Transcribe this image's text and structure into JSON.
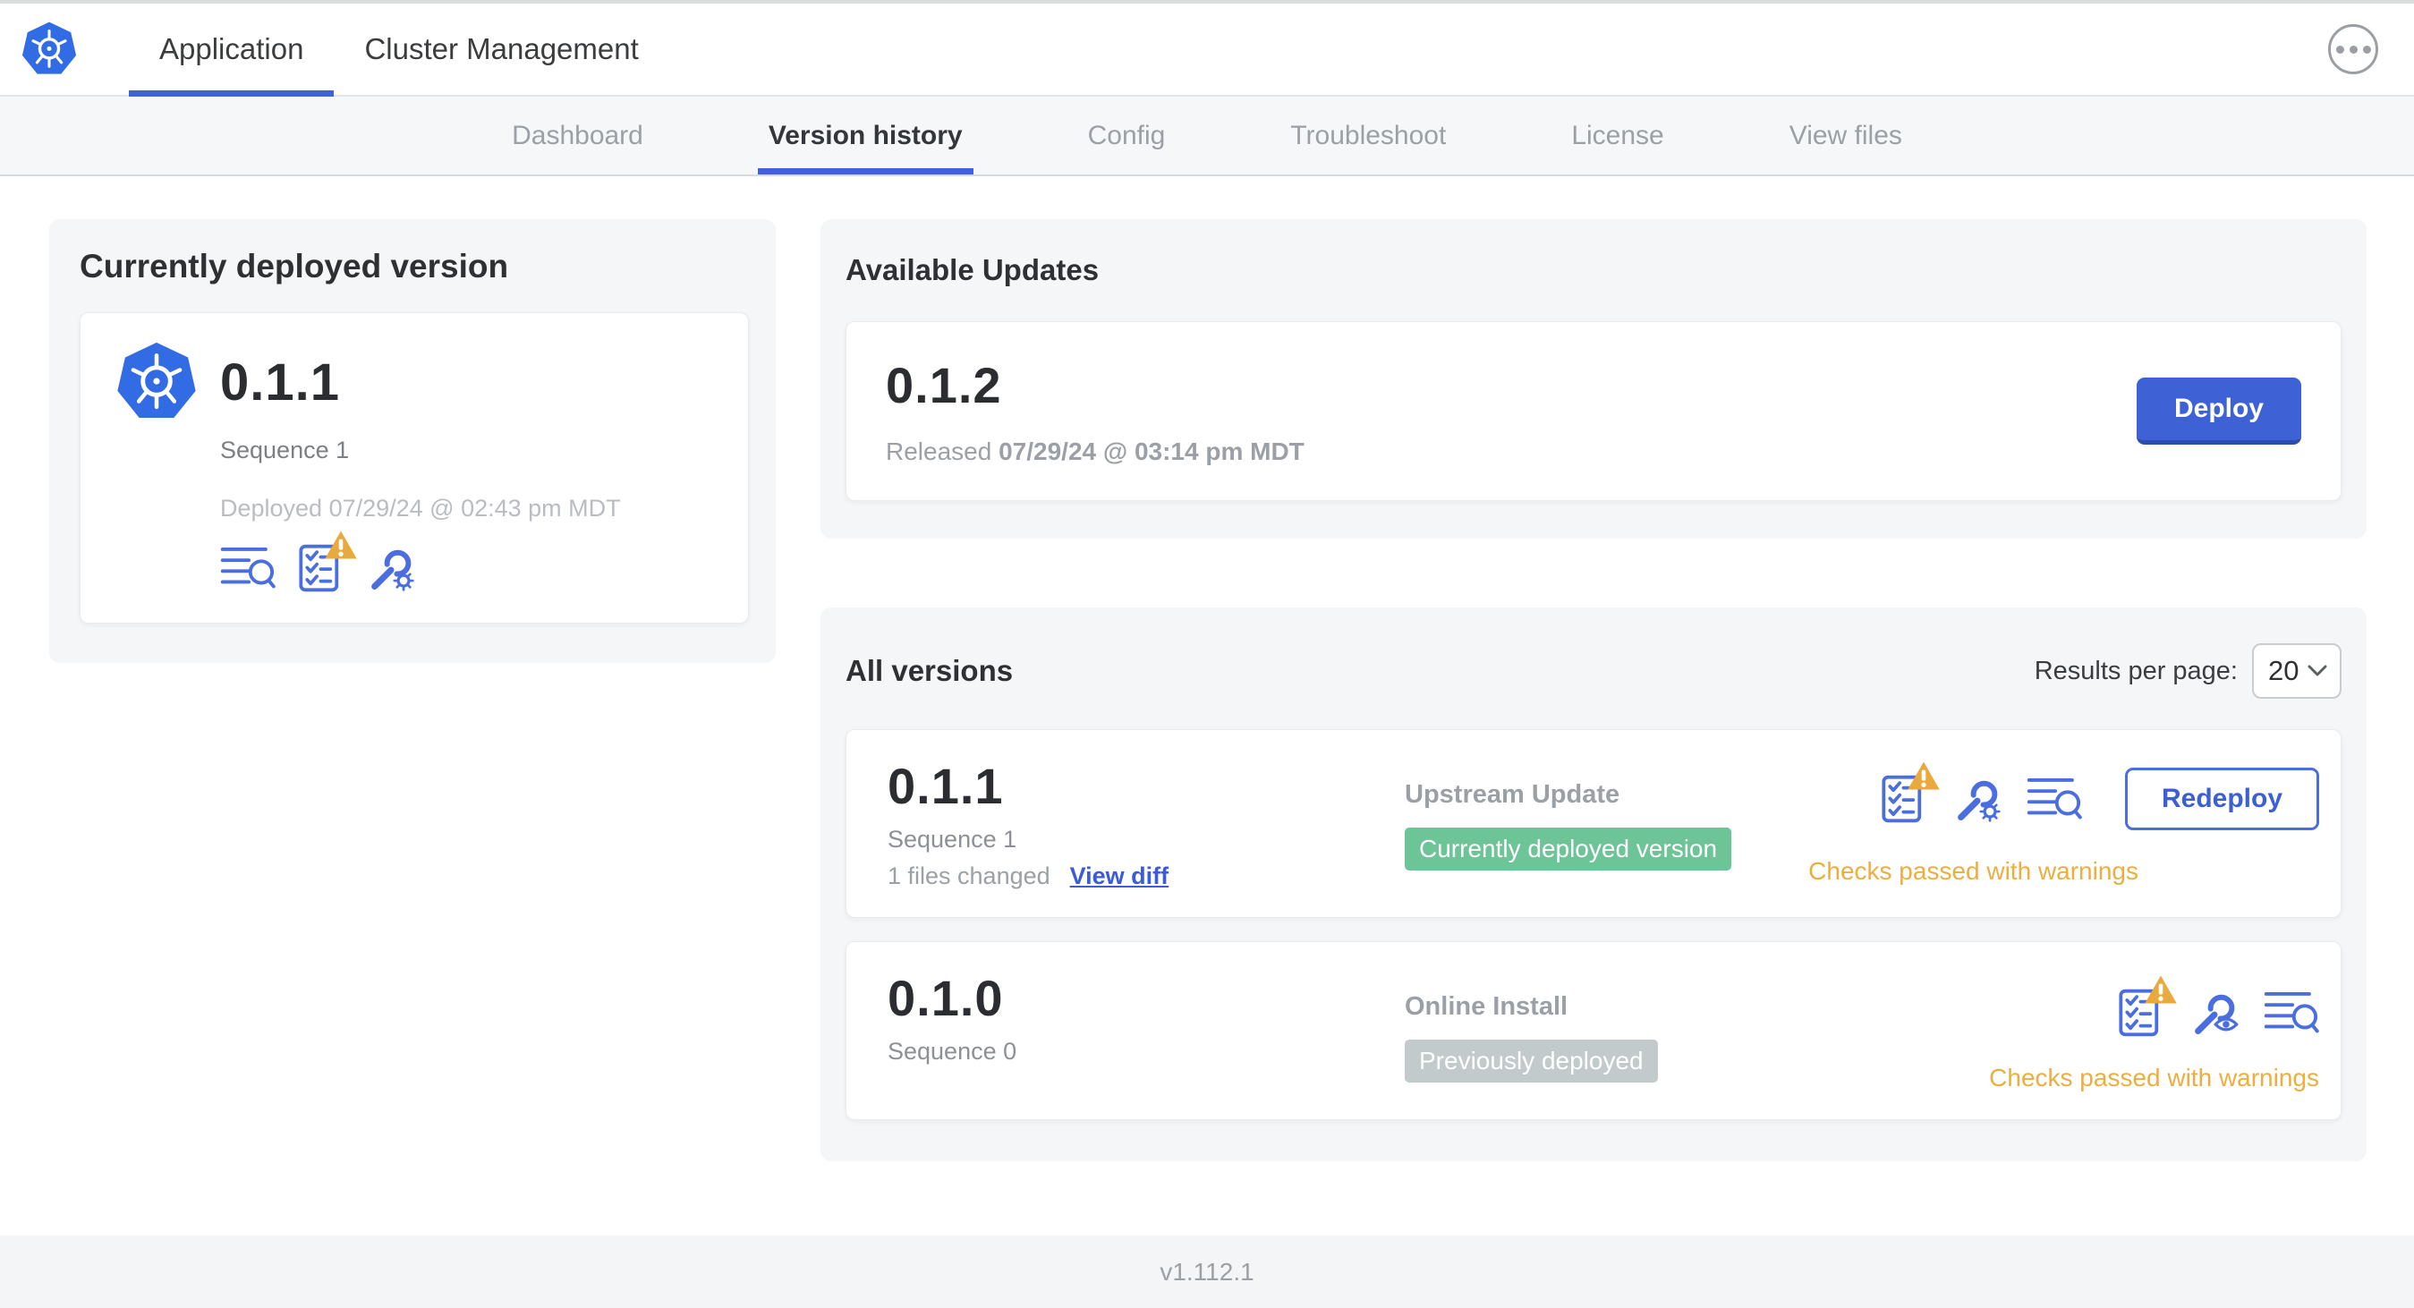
{
  "header": {
    "logo_icon": "kubernetes-logo-icon",
    "tabs": [
      {
        "label": "Application",
        "active": true
      },
      {
        "label": "Cluster Management",
        "active": false
      }
    ],
    "more_menu_icon": "ellipsis-menu-icon"
  },
  "subnav": {
    "tabs": [
      {
        "label": "Dashboard",
        "active": false
      },
      {
        "label": "Version history",
        "active": true
      },
      {
        "label": "Config",
        "active": false
      },
      {
        "label": "Troubleshoot",
        "active": false
      },
      {
        "label": "License",
        "active": false
      },
      {
        "label": "View files",
        "active": false
      }
    ]
  },
  "current_version_card": {
    "title": "Currently deployed version",
    "app_icon": "kubernetes-logo-icon",
    "version": "0.1.1",
    "sequence": "Sequence 1",
    "deployed": "Deployed 07/29/24 @ 02:43 pm MDT",
    "icons": [
      "release-notes-icon",
      "preflight-checks-warning-icon",
      "config-icon"
    ]
  },
  "available_updates": {
    "title": "Available Updates",
    "version": "0.1.2",
    "released_prefix": "Released ",
    "released_date": "07/29/24 @ 03:14 pm MDT",
    "deploy_label": "Deploy"
  },
  "all_versions": {
    "title": "All versions",
    "results_per_page_label": "Results per page:",
    "results_per_page_value": "20",
    "rows": [
      {
        "version": "0.1.1",
        "sequence": "Sequence 1",
        "files_changed": "1 files changed",
        "view_diff_label": "View diff",
        "source": "Upstream Update",
        "badge": "Currently deployed version",
        "badge_color": "#6cc497",
        "icons": [
          "preflight-checks-warning-icon",
          "config-icon",
          "release-notes-icon"
        ],
        "action_label": "Redeploy",
        "checks_text": "Checks passed with warnings"
      },
      {
        "version": "0.1.0",
        "sequence": "Sequence 0",
        "source": "Online Install",
        "badge": "Previously deployed",
        "badge_color": "#c2cacc",
        "icons": [
          "preflight-checks-warning-icon",
          "view-config-icon",
          "release-notes-icon"
        ],
        "checks_text": "Checks passed with warnings"
      }
    ]
  },
  "footer": {
    "version": "v1.112.1"
  },
  "colors": {
    "accent_blue": "#3f62d9",
    "button_blue": "#3e61d6",
    "icon_blue": "#4a6ee0",
    "link_blue": "#3b5bdc",
    "kubernetes_blue": "#326ce5",
    "warning_amber": "#ecae3f",
    "badge_green": "#6cc497",
    "badge_gray": "#c2cacc",
    "card_background": "#f4f6f8"
  }
}
